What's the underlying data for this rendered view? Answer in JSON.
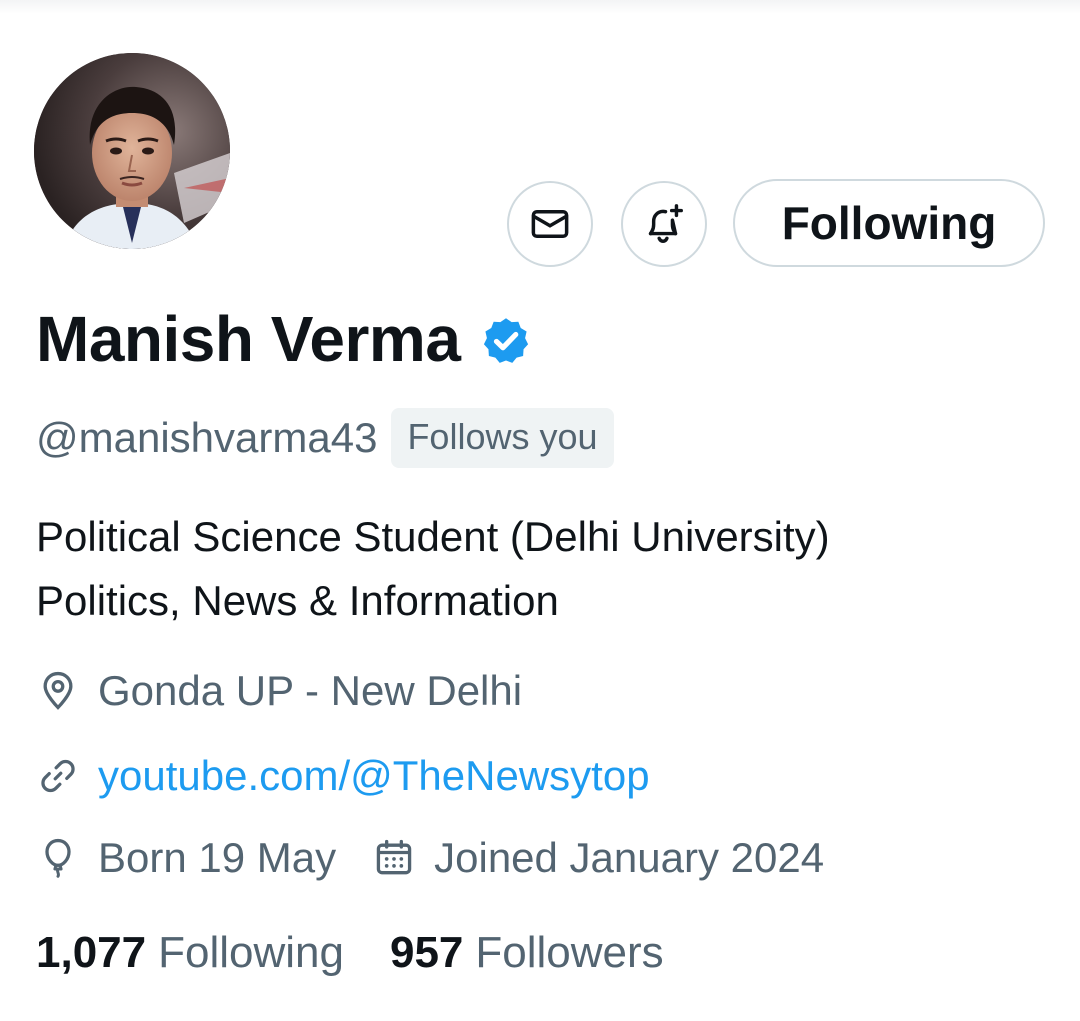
{
  "profile": {
    "display_name": "Manish Verma",
    "handle": "@manishvarma43",
    "follows_you": "Follows you",
    "bio_lines": [
      "Political Science Student (Delhi University)",
      "Politics, News & Information"
    ],
    "location": "Gonda UP -  New Delhi",
    "website": "youtube.com/@TheNewsytop",
    "born": "Born 19 May",
    "joined": "Joined January 2024",
    "verified": true
  },
  "actions": {
    "message_icon": "envelope-icon",
    "notify_icon": "bell-plus-icon",
    "follow_label": "Following"
  },
  "stats": {
    "following_count": "1,077",
    "following_label": "Following",
    "followers_count": "957",
    "followers_label": "Followers"
  },
  "colors": {
    "text_primary": "#0f1419",
    "text_secondary": "#536471",
    "link": "#1d9bf0",
    "verified_badge": "#1d9bf0",
    "border": "#cfd9de",
    "badge_bg": "#eff3f4"
  },
  "icons": {
    "location": "location-pin-icon",
    "link": "link-icon",
    "born": "balloon-icon",
    "joined": "calendar-icon",
    "verified": "verified-badge-icon"
  }
}
